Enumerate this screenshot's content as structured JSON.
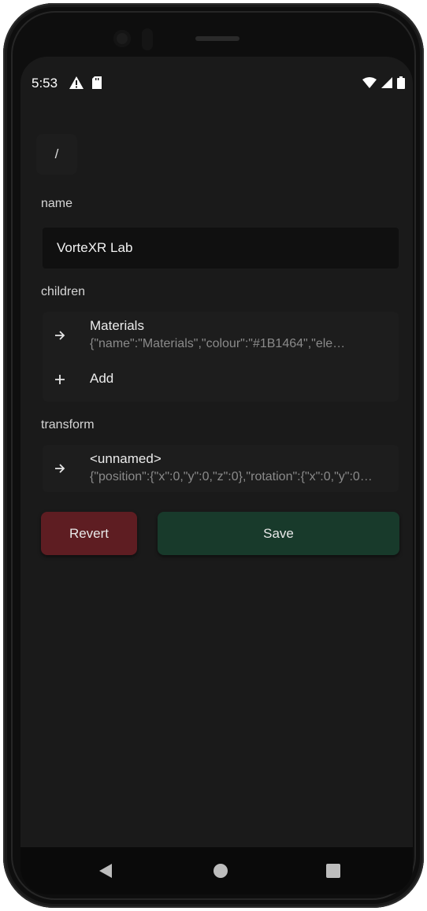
{
  "status_bar": {
    "time": "5:53",
    "left_icons": [
      "warning-icon",
      "sd-card-icon"
    ],
    "right_icons": [
      "wifi-icon",
      "signal-icon",
      "battery-icon"
    ]
  },
  "breadcrumb": {
    "path": "/"
  },
  "name_section": {
    "label": "name",
    "value": "VorteXR Lab"
  },
  "children_section": {
    "label": "children",
    "items": [
      {
        "title": "Materials",
        "subtitle": "{\"name\":\"Materials\",\"colour\":\"#1B1464\",\"ele…",
        "icon": "arrow-right-icon"
      }
    ],
    "add_label": "Add",
    "add_icon": "plus-icon"
  },
  "transform_section": {
    "label": "transform",
    "items": [
      {
        "title": "<unnamed>",
        "subtitle": "{\"position\":{\"x\":0,\"y\":0,\"z\":0},\"rotation\":{\"x\":0,\"y\":0…",
        "icon": "arrow-right-icon"
      }
    ]
  },
  "actions": {
    "revert_label": "Revert",
    "save_label": "Save"
  },
  "colors": {
    "background": "#1a1a1a",
    "revert": "#5e1d22",
    "save": "#183a2b"
  },
  "nav_bar": {
    "buttons": [
      "back-icon",
      "home-icon",
      "recents-icon"
    ]
  }
}
